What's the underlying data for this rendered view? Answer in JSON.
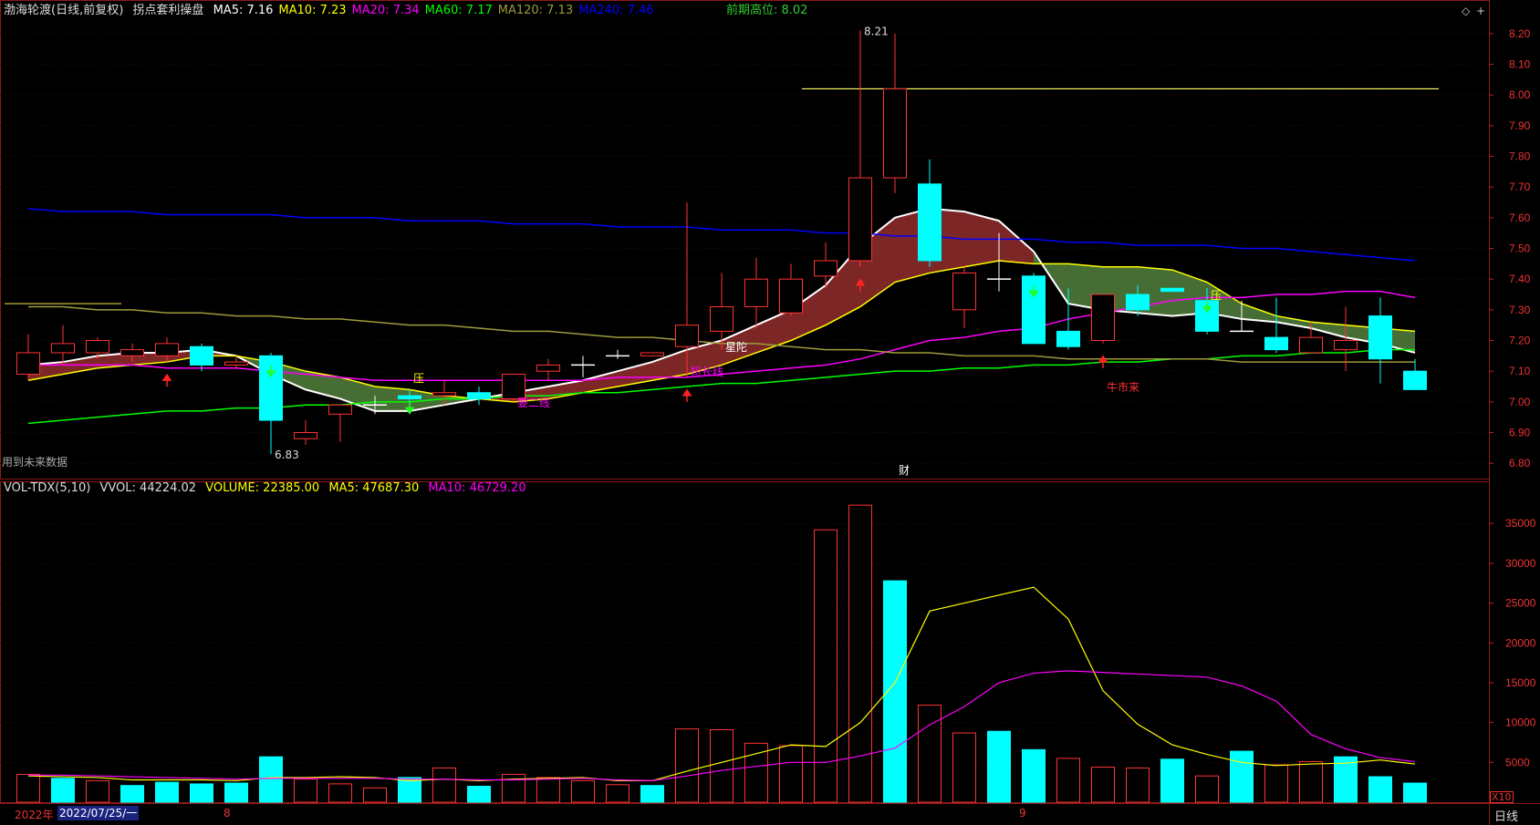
{
  "header": {
    "stock": "渤海轮渡(日线,前复权)",
    "indicator": "拐点套利操盘",
    "items": [
      {
        "label": "MA5: 7.16",
        "color": "#ffffff"
      },
      {
        "label": "MA10: 7.23",
        "color": "#ffff00"
      },
      {
        "label": "MA20: 7.34",
        "color": "#ff00ff"
      },
      {
        "label": "MA60: 7.17",
        "color": "#00ff00"
      },
      {
        "label": "MA120: 7.13",
        "color": "#9c9c3c"
      },
      {
        "label": "MA240: 7.46",
        "color": "#0000ff"
      }
    ],
    "prev_high": "前期高位: 8.02"
  },
  "vol_header": {
    "name": "VOL-TDX(5,10)",
    "vvol": "VVOL: 44224.02",
    "volume": "VOLUME: 22385.00",
    "ma5": "MA5: 47687.30",
    "ma10": "MA10: 46729.20"
  },
  "footer": {
    "future_note": "用到未来数据",
    "year": "2022年",
    "date": "2022/07/25/一",
    "month8": "8",
    "month9": "9",
    "period": "日线",
    "x10": "X10"
  },
  "chart_data": [
    {
      "type": "candlestick",
      "title": "渤海轮渡(日线,前复权)",
      "ylim": [
        6.75,
        8.25
      ],
      "yticks": [
        6.8,
        6.9,
        7.0,
        7.1,
        7.2,
        7.3,
        7.4,
        7.5,
        7.6,
        7.7,
        7.8,
        7.9,
        8.0,
        8.1,
        8.2
      ],
      "candles": [
        {
          "o": 7.09,
          "h": 7.22,
          "l": 7.07,
          "c": 7.16
        },
        {
          "o": 7.16,
          "h": 7.25,
          "l": 7.12,
          "c": 7.19
        },
        {
          "o": 7.16,
          "h": 7.21,
          "l": 7.14,
          "c": 7.2
        },
        {
          "o": 7.15,
          "h": 7.19,
          "l": 7.13,
          "c": 7.17
        },
        {
          "o": 7.15,
          "h": 7.21,
          "l": 7.13,
          "c": 7.19
        },
        {
          "o": 7.18,
          "h": 7.19,
          "l": 7.1,
          "c": 7.12
        },
        {
          "o": 7.12,
          "h": 7.15,
          "l": 7.11,
          "c": 7.13
        },
        {
          "o": 7.15,
          "h": 7.16,
          "l": 6.83,
          "c": 6.94
        },
        {
          "o": 6.88,
          "h": 6.94,
          "l": 6.86,
          "c": 6.9
        },
        {
          "o": 6.96,
          "h": 6.99,
          "l": 6.87,
          "c": 6.99
        },
        {
          "o": 6.99,
          "h": 7.02,
          "l": 6.96,
          "c": 6.99
        },
        {
          "o": 7.02,
          "h": 7.04,
          "l": 6.98,
          "c": 7.01
        },
        {
          "o": 7.02,
          "h": 7.07,
          "l": 6.99,
          "c": 7.03
        },
        {
          "o": 7.03,
          "h": 7.05,
          "l": 6.99,
          "c": 7.01
        },
        {
          "o": 7.01,
          "h": 7.09,
          "l": 7.0,
          "c": 7.09
        },
        {
          "o": 7.1,
          "h": 7.14,
          "l": 7.07,
          "c": 7.12
        },
        {
          "o": 7.12,
          "h": 7.15,
          "l": 7.08,
          "c": 7.12
        },
        {
          "o": 7.15,
          "h": 7.17,
          "l": 7.14,
          "c": 7.15
        },
        {
          "o": 7.15,
          "h": 7.16,
          "l": 7.15,
          "c": 7.16
        },
        {
          "o": 7.18,
          "h": 7.65,
          "l": 7.08,
          "c": 7.25
        },
        {
          "o": 7.23,
          "h": 7.42,
          "l": 7.17,
          "c": 7.31
        },
        {
          "o": 7.31,
          "h": 7.47,
          "l": 7.24,
          "c": 7.4
        },
        {
          "o": 7.29,
          "h": 7.45,
          "l": 7.28,
          "c": 7.4
        },
        {
          "o": 7.41,
          "h": 7.52,
          "l": 7.37,
          "c": 7.46
        },
        {
          "o": 7.46,
          "h": 8.21,
          "l": 7.44,
          "c": 7.73
        },
        {
          "o": 7.73,
          "h": 8.2,
          "l": 7.68,
          "c": 8.02
        },
        {
          "o": 7.71,
          "h": 7.79,
          "l": 7.44,
          "c": 7.46
        },
        {
          "o": 7.3,
          "h": 7.44,
          "l": 7.24,
          "c": 7.42
        },
        {
          "o": 7.4,
          "h": 7.55,
          "l": 7.36,
          "c": 7.4
        },
        {
          "o": 7.41,
          "h": 7.42,
          "l": 7.19,
          "c": 7.19
        },
        {
          "o": 7.23,
          "h": 7.37,
          "l": 7.17,
          "c": 7.18
        },
        {
          "o": 7.2,
          "h": 7.33,
          "l": 7.19,
          "c": 7.35
        },
        {
          "o": 7.35,
          "h": 7.38,
          "l": 7.28,
          "c": 7.3
        },
        {
          "o": 7.37,
          "h": 7.37,
          "l": 7.36,
          "c": 7.36
        },
        {
          "o": 7.33,
          "h": 7.37,
          "l": 7.22,
          "c": 7.23
        },
        {
          "o": 7.23,
          "h": 7.33,
          "l": 7.23,
          "c": 7.23
        },
        {
          "o": 7.21,
          "h": 7.34,
          "l": 7.16,
          "c": 7.17
        },
        {
          "o": 7.16,
          "h": 7.26,
          "l": 7.16,
          "c": 7.21
        },
        {
          "o": 7.17,
          "h": 7.31,
          "l": 7.1,
          "c": 7.2
        },
        {
          "o": 7.28,
          "h": 7.34,
          "l": 7.06,
          "c": 7.14
        },
        {
          "o": 7.1,
          "h": 7.14,
          "l": 7.04,
          "c": 7.04
        }
      ],
      "series": [
        {
          "name": "MA5",
          "color": "#ffffff",
          "values": [
            7.12,
            7.13,
            7.15,
            7.16,
            7.16,
            7.17,
            7.15,
            7.09,
            7.04,
            7.01,
            6.97,
            6.97,
            6.99,
            7.01,
            7.03,
            7.05,
            7.07,
            7.1,
            7.13,
            7.17,
            7.2,
            7.25,
            7.3,
            7.38,
            7.51,
            7.6,
            7.63,
            7.62,
            7.59,
            7.49,
            7.32,
            7.3,
            7.29,
            7.28,
            7.29,
            7.27,
            7.26,
            7.24,
            7.21,
            7.19,
            7.16
          ]
        },
        {
          "name": "MA10",
          "color": "#ffff00",
          "values": [
            7.07,
            7.09,
            7.11,
            7.12,
            7.13,
            7.15,
            7.15,
            7.13,
            7.1,
            7.08,
            7.05,
            7.04,
            7.02,
            7.01,
            7.0,
            7.01,
            7.03,
            7.05,
            7.07,
            7.09,
            7.12,
            7.16,
            7.2,
            7.25,
            7.31,
            7.39,
            7.42,
            7.44,
            7.46,
            7.45,
            7.45,
            7.44,
            7.44,
            7.43,
            7.39,
            7.32,
            7.28,
            7.26,
            7.25,
            7.24,
            7.23
          ]
        },
        {
          "name": "MA20",
          "color": "#ff00ff",
          "values": [
            7.12,
            7.12,
            7.12,
            7.12,
            7.11,
            7.11,
            7.11,
            7.1,
            7.09,
            7.08,
            7.07,
            7.07,
            7.07,
            7.07,
            7.07,
            7.07,
            7.07,
            7.08,
            7.08,
            7.08,
            7.09,
            7.1,
            7.11,
            7.12,
            7.14,
            7.17,
            7.2,
            7.21,
            7.23,
            7.24,
            7.27,
            7.29,
            7.31,
            7.33,
            7.34,
            7.34,
            7.35,
            7.35,
            7.36,
            7.36,
            7.34
          ]
        },
        {
          "name": "MA60",
          "color": "#00ff00",
          "values": [
            6.93,
            6.94,
            6.95,
            6.96,
            6.97,
            6.97,
            6.98,
            6.98,
            6.99,
            6.99,
            7.0,
            7.0,
            7.01,
            7.01,
            7.02,
            7.02,
            7.03,
            7.03,
            7.04,
            7.05,
            7.06,
            7.06,
            7.07,
            7.08,
            7.09,
            7.1,
            7.1,
            7.11,
            7.11,
            7.12,
            7.12,
            7.13,
            7.13,
            7.14,
            7.14,
            7.15,
            7.15,
            7.16,
            7.16,
            7.17,
            7.17
          ]
        },
        {
          "name": "MA120",
          "color": "#9c9c3c",
          "values": [
            7.31,
            7.31,
            7.3,
            7.3,
            7.29,
            7.29,
            7.28,
            7.28,
            7.27,
            7.27,
            7.26,
            7.25,
            7.25,
            7.24,
            7.23,
            7.23,
            7.22,
            7.21,
            7.21,
            7.2,
            7.19,
            7.19,
            7.18,
            7.17,
            7.17,
            7.16,
            7.16,
            7.15,
            7.15,
            7.15,
            7.14,
            7.14,
            7.14,
            7.14,
            7.14,
            7.13,
            7.13,
            7.13,
            7.13,
            7.13,
            7.13
          ]
        },
        {
          "name": "MA240",
          "color": "#0000ff",
          "values": [
            7.63,
            7.62,
            7.62,
            7.62,
            7.61,
            7.61,
            7.61,
            7.61,
            7.6,
            7.6,
            7.6,
            7.59,
            7.59,
            7.59,
            7.58,
            7.58,
            7.58,
            7.57,
            7.57,
            7.57,
            7.56,
            7.56,
            7.56,
            7.55,
            7.55,
            7.54,
            7.54,
            7.53,
            7.53,
            7.53,
            7.52,
            7.52,
            7.51,
            7.51,
            7.51,
            7.5,
            7.5,
            7.49,
            7.48,
            7.47,
            7.46
          ]
        }
      ],
      "extra_lines": [
        {
          "color": "#c8b43c",
          "value": 7.32,
          "from": 0,
          "to": 2
        },
        {
          "color": "#ffff64",
          "value": 8.02,
          "from": 23,
          "to": 40
        }
      ],
      "annotations": [
        {
          "text": "8.21",
          "i": 24,
          "value": 8.21,
          "color": "#dddddd"
        },
        {
          "text": "6.83",
          "i": 7,
          "value": 6.83,
          "color": "#dddddd"
        },
        {
          "text": "压",
          "i": 11,
          "value": 7.08,
          "color": "#ffff00"
        },
        {
          "text": "压",
          "i": 34,
          "value": 7.35,
          "color": "#ffff00"
        },
        {
          "text": "要二线",
          "i": 14,
          "value": 7.0,
          "color": "#ff00ff"
        },
        {
          "text": "短长线",
          "i": 19,
          "value": 7.1,
          "color": "#ff00ff"
        },
        {
          "text": "星陀",
          "i": 20,
          "value": 7.18,
          "color": "#ffffff"
        },
        {
          "text": "牛市来",
          "i": 31,
          "value": 7.05,
          "color": "#ff3333"
        },
        {
          "text": "财",
          "i": 25,
          "value": 6.78,
          "color": "#ffffff"
        }
      ],
      "up_arrows": [
        4,
        19,
        24,
        31
      ],
      "down_arrows": [
        7,
        11,
        29,
        34
      ]
    },
    {
      "type": "bar",
      "title": "VOL-TDX(5,10)",
      "ylim": [
        0,
        38000
      ],
      "yticks": [
        5000,
        10000,
        15000,
        20000,
        25000,
        30000,
        35000
      ],
      "values": [
        3500,
        3000,
        2700,
        2100,
        2500,
        2300,
        2400,
        5700,
        2900,
        2300,
        1800,
        3100,
        4300,
        2000,
        3500,
        3100,
        2700,
        2200,
        2100,
        9200,
        9100,
        7400,
        7100,
        34200,
        37300,
        27800,
        12200,
        8700,
        8900,
        6600,
        5500,
        4400,
        4300,
        5400,
        3300,
        6400,
        4700,
        5100,
        5700,
        3200,
        2400
      ],
      "rising": [
        true,
        false,
        true,
        false,
        false,
        false,
        false,
        false,
        true,
        true,
        true,
        false,
        true,
        false,
        true,
        true,
        true,
        true,
        false,
        true,
        true,
        true,
        true,
        true,
        true,
        false,
        true,
        true,
        false,
        false,
        true,
        true,
        true,
        false,
        true,
        false,
        true,
        true,
        false,
        false,
        false
      ],
      "ma5": [
        3300,
        3200,
        3100,
        2800,
        2800,
        2800,
        2700,
        3100,
        3100,
        3200,
        3100,
        2700,
        2900,
        2700,
        2900,
        3000,
        3100,
        2700,
        2700,
        3900,
        5000,
        6100,
        7200,
        7000,
        10000,
        15000,
        24000,
        25000,
        26000,
        27000,
        23000,
        14000,
        9800,
        7200,
        6000,
        5000,
        4600,
        4800,
        4900,
        5300,
        4800
      ],
      "ma10": [
        3400,
        3400,
        3300,
        3200,
        3100,
        3000,
        2900,
        3000,
        3000,
        3000,
        3000,
        2900,
        2900,
        2800,
        2800,
        2900,
        3000,
        2800,
        2700,
        3300,
        4000,
        4500,
        5000,
        5000,
        5800,
        6800,
        9700,
        12000,
        15000,
        16200,
        16500,
        16300,
        16100,
        15900,
        15700,
        14600,
        12700,
        8500,
        6700,
        5600,
        5100
      ],
      "series_colors": {
        "ma5": "#ffff00",
        "ma10": "#ff00ff"
      },
      "ylabel_unit": "X10"
    }
  ]
}
